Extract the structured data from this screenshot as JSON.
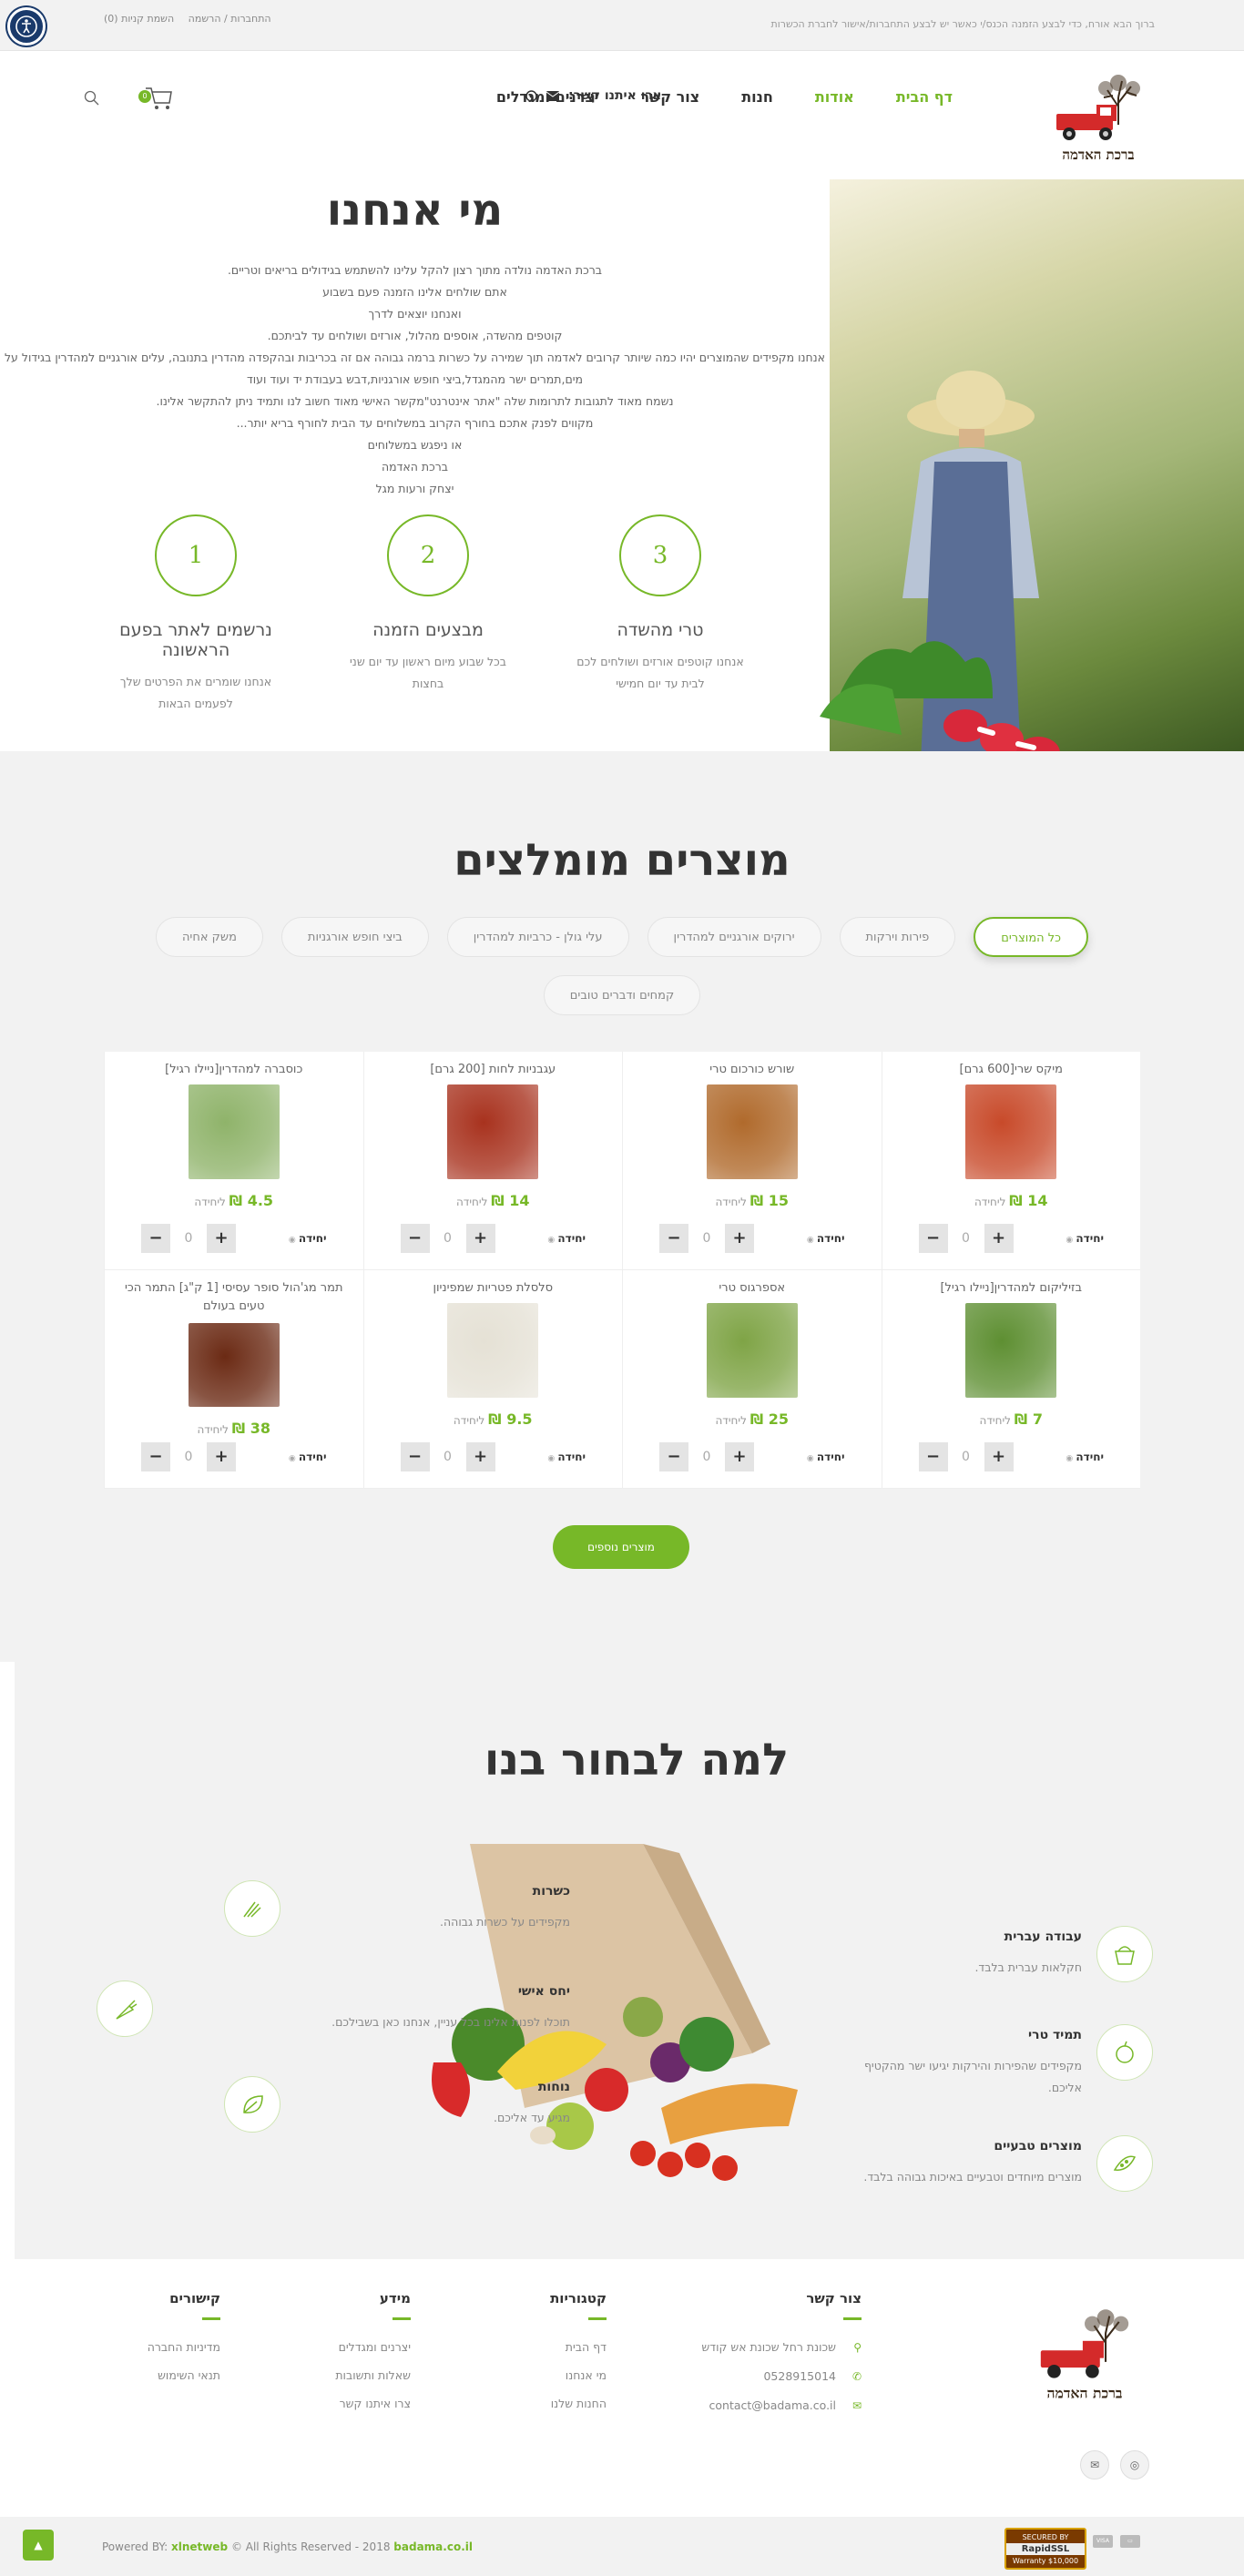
{
  "topbar": {
    "notice": "ברוך הבא אורח, כדי לבצע הזמנה הכנס/י כאשר יש לבצע התחברות/אישור לחברת הכשרות",
    "login": "התחברות / הרשמה",
    "orders": "השמת קניות (0)"
  },
  "header": {
    "logo_text": "ברכת האדמה",
    "nav": [
      "דף הבית",
      "אודות",
      "חנות",
      "צור קשר",
      "יצרנים ומגדלים"
    ],
    "contact_label": "צרו איתנו קשר:",
    "cart_count": "0"
  },
  "about": {
    "title": "מי אנחנו",
    "lines": [
      "ברכת האדמה נולדה מתוך רצון להקל עלינו להשתמש בגידולים בריאים וטריים.",
      "אתם שולחים אלינו הזמנה פעם בשבוע",
      "ואנחנו יוצאים לדרך",
      "קוטפים מהשדה, אוספים מהלול, אורזים ושולחים עד לביתכם.",
      "אנחנו מקפידים שהמוצרים יהיו כמה שיותר קרובים לאדמה תוך שמירה על כשרות ברמה גבוהה אם זה בכריבות ובהקפדה מהדרין בתנובה, עלים אורגניים למהדרין בגידול על",
      "מים,תמרים ישר מהמגדל,ביצי חופש אורגניות,דבש בעבודת יד ועוד ועוד",
      "נשמח מאוד לתגובות לתרומות שלה \"אתר אינטרנט\"מקשר האישי מאוד חשוב לנו ותמיד ניתן להתקשר אלינו.",
      "מקווים לפנק אתכם בחורף הקרוב במשלוחים עד הבית לחורף בריא יותר...",
      "או ניפגש במשלוחים",
      "ברכת האדמה",
      "יצחק ורעות מגל"
    ],
    "steps": [
      {
        "num": "1",
        "title": "נרשמים לאתר בפעם הראשונה",
        "text": "אנחנו שומרים את הפרטים שלך לפעמים הבאות"
      },
      {
        "num": "2",
        "title": "מבצעים הזמנה",
        "text": "בכל שבוע מיום ראשון עד יום שני בחצות"
      },
      {
        "num": "3",
        "title": "טרי מהשדה",
        "text": "אנחנו קוטפים אורזים ושולחים לכם לבית עד יום חמישי"
      }
    ]
  },
  "products": {
    "title": "מוצרים מומלצים",
    "filters": [
      "כל המוצרים",
      "פירות וירקות",
      "ירוקים אורגניים למהדרין",
      "עלי גולן - כרביות למהדרין",
      "ביצי חופש אורגניות",
      "משק אחיה",
      "קמחים ודברים טובים"
    ],
    "currency_label": "₪",
    "per_unit": "ליחידה",
    "unit_label": "יחידה",
    "qty": "0",
    "items": [
      {
        "name": "מיקס שרי[600 גרם]",
        "price": "14",
        "color": "#c84a2a"
      },
      {
        "name": "שורש כורכום טרי",
        "price": "15",
        "color": "#b06a2c"
      },
      {
        "name": "עגבניות לחות [200 גרם]",
        "price": "14",
        "color": "#a8321e"
      },
      {
        "name": "כוסברה למהדרין[ניילו רגיל]",
        "price": "4.5",
        "color": "#8fb36a"
      },
      {
        "name": "בזיליקום למהדרין[ניילו רגיל]",
        "price": "7",
        "color": "#5e8f32"
      },
      {
        "name": "אספרגוס טרי",
        "price": "25",
        "color": "#7fa446"
      },
      {
        "name": "סלסלת פטריות שמפיניון",
        "price": "9.5",
        "color": "#e5e1d5"
      },
      {
        "name": "תמר מג'הול סופר עסיסי [1 ק\"ג] התמר הכי טעים בעולם",
        "price": "38",
        "color": "#6b2a14"
      }
    ],
    "more_button": "מוצרים נוספים"
  },
  "why": {
    "title": "למה לבחור בנו",
    "features": [
      {
        "title": "עבודה עברית",
        "text": "חקלאות עברית בלבד."
      },
      {
        "title": "תמיד טרי",
        "text": "מקפידים שהפירות והירקות יגיעו ישר מהקטיף אליכם."
      },
      {
        "title": "מוצרים טבעיים",
        "text": "מוצרים מיוחדים וטבעיים באיכות גבוהה בלבד."
      },
      {
        "title": "כשרות",
        "text": "מקפידים על כשרות גבוהה."
      },
      {
        "title": "יחס אישי",
        "text": "תוכלו לפנות אלינו בכל עניין, אנחנו כאן בשבילכם."
      },
      {
        "title": "נוחות",
        "text": "מגיע עד אליכם."
      }
    ]
  },
  "footer": {
    "contact": {
      "title": "צור קשר",
      "address": "שכונת רחל שכונת אש קודש",
      "phone": "0528915014",
      "email": "contact@badama.co.il"
    },
    "categories": {
      "title": "קטגוריות",
      "items": [
        "דף הבית",
        "מי אנחנו",
        "החנות שלנו"
      ]
    },
    "info": {
      "title": "מידע",
      "items": [
        "יצרנים ומגדלים",
        "שאלות ותשובות",
        "צרו איתנו קשר"
      ]
    },
    "links": {
      "title": "קישורים",
      "items": [
        "מדיניות החברה",
        "תנאי השימוש"
      ]
    },
    "powered": "Powered BY:",
    "powered_brand": "xlnetweb",
    "rights": "© All Rights Reserved - 2018",
    "site": "badama.co.il",
    "ssl_top": "SECURED BY",
    "ssl_mid": "RapidSSL",
    "ssl_bottom": "$10,000 Warranty"
  },
  "colors": {
    "accent": "#77b828",
    "bg_light": "#f2f2f2",
    "text_dark": "#333333"
  }
}
